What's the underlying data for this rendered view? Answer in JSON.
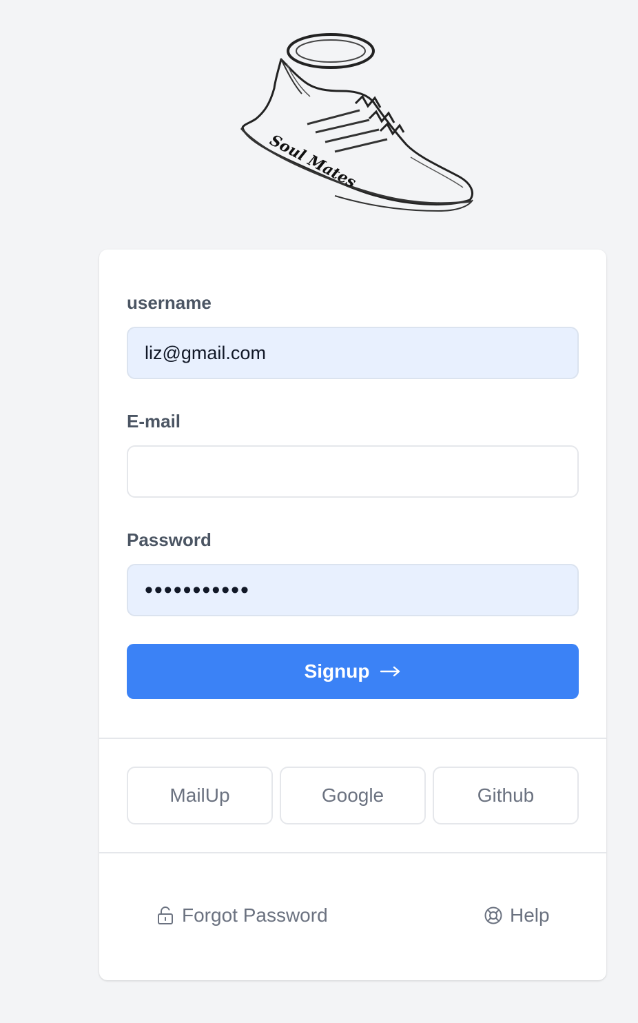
{
  "logo": {
    "text": "Soul Mates",
    "icon": "winged-sneaker-halo-logo"
  },
  "form": {
    "username_label": "username",
    "username_value": "liz@gmail.com",
    "email_label": "E-mail",
    "email_value": "",
    "password_label": "Password",
    "password_value": "•••••••••••",
    "signup_label": "Signup",
    "signup_icon": "arrow-right-icon"
  },
  "social": {
    "buttons": [
      "MailUp",
      "Google",
      "Github"
    ]
  },
  "footer": {
    "forgot_label": "Forgot Password",
    "forgot_icon": "unlock-icon",
    "help_label": "Help",
    "help_icon": "lifebuoy-icon"
  },
  "colors": {
    "background": "#f3f4f6",
    "card": "#ffffff",
    "primary": "#3b82f6",
    "autofill": "#e8f0fe",
    "muted_text": "#6b7280",
    "label_text": "#4b5563"
  }
}
